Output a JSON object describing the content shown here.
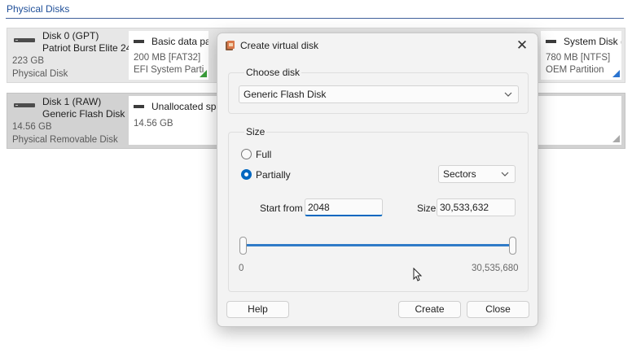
{
  "section": {
    "title": "Physical Disks"
  },
  "disks": [
    {
      "name_line1": "Disk 0 (GPT)",
      "name_line2": "Patriot Burst Elite 24",
      "size": "223 GB",
      "type": "Physical Disk",
      "partitions": [
        {
          "name": "Basic data pa",
          "line1": "200 MB [FAT32]",
          "line2": "EFI System Parti",
          "corner_color": "#3a9d3a"
        },
        {
          "name": "System Disk (",
          "line1": "780 MB [NTFS]",
          "line2": "OEM Partition",
          "corner_color": "#2a74d0"
        }
      ]
    },
    {
      "name_line1": "Disk 1 (RAW)",
      "name_line2": "Generic Flash Disk",
      "size": "14.56 GB",
      "type": "Physical Removable Disk",
      "partitions": [
        {
          "name": "Unallocated spa",
          "line1": "14.56 GB",
          "corner_color": "#a9a9a9"
        }
      ]
    }
  ],
  "dialog": {
    "title": "Create virtual disk",
    "close_icon": "close-icon",
    "choose_disk": {
      "label": "Choose disk",
      "selected": "Generic Flash Disk"
    },
    "size_group": {
      "label": "Size",
      "option_full": "Full",
      "option_partially": "Partially",
      "selected_option": "Partially",
      "unit_selected": "Sectors",
      "start_label": "Start from",
      "start_value": "2048",
      "size_label": "Size",
      "size_value": "30,533,632",
      "range_min": "0",
      "range_max": "30,535,680"
    },
    "buttons": {
      "help": "Help",
      "create": "Create",
      "close": "Close"
    }
  },
  "colors": {
    "accent": "#0067c0",
    "slider": "#2f7bc8",
    "section_title": "#1f4f99"
  }
}
